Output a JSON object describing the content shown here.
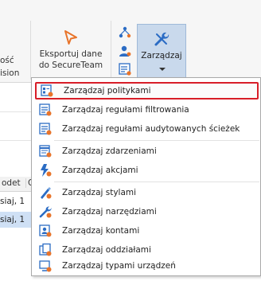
{
  "ribbon": {
    "left_fragment_1": "ość",
    "left_fragment_2": "ision",
    "export_label_1": "Eksportuj dane",
    "export_label_2": "do SecureTeam",
    "manage_label": "Zarządzaj"
  },
  "grid": {
    "header_1": "odet",
    "header_2": "O",
    "row_1": "siaj, 1",
    "row_2": "siaj, 1"
  },
  "menu": {
    "items": [
      {
        "label": "Zarządzaj politykami",
        "icon": "policy-icon",
        "highlighted": true
      },
      {
        "label": "Zarządzaj regułami filtrowania",
        "icon": "filter-rules-icon"
      },
      {
        "label": "Zarządzaj regułami audytowanych ścieżek",
        "icon": "audit-path-rules-icon"
      },
      {
        "label": "Zarządzaj zdarzeniami",
        "icon": "events-icon"
      },
      {
        "label": "Zarządzaj akcjami",
        "icon": "actions-icon"
      },
      {
        "label": "Zarządzaj stylami",
        "icon": "styles-icon"
      },
      {
        "label": "Zarządzaj narzędziami",
        "icon": "tools-icon"
      },
      {
        "label": "Zarządzaj kontami",
        "icon": "accounts-icon"
      },
      {
        "label": "Zarządzaj oddziałami",
        "icon": "branches-icon"
      },
      {
        "label": "Zarządzaj typami urządzeń",
        "icon": "device-types-icon"
      }
    ]
  },
  "colors": {
    "highlight_border": "#d81e28",
    "active_button_bg": "#c9d9ec",
    "accent_orange": "#e8742a",
    "icon_blue": "#2b6cc4"
  }
}
